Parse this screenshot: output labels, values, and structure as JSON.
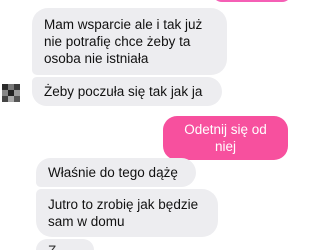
{
  "conversation": {
    "messages": [
      {
        "direction": "incoming",
        "text": "Mam wsparcie ale i tak już\nnie potrafię chce żeby ta\nosoba nie istniała"
      },
      {
        "direction": "incoming",
        "text": "Żeby poczuła się tak jak ja"
      },
      {
        "direction": "outgoing",
        "text": "Odetnij się od niej"
      },
      {
        "direction": "incoming",
        "text": "Właśnie do tego dążę"
      },
      {
        "direction": "incoming",
        "text": "Jutro to zrobię jak będzie\nsam w domu"
      },
      {
        "direction": "incoming",
        "text": "Z rana"
      }
    ]
  },
  "colors": {
    "incoming_bubble": "#ededf0",
    "outgoing_bubble": "#f7509e",
    "background": "#ffffff"
  },
  "icons": {
    "contact_avatar": "pixelated-avatar-icon"
  }
}
